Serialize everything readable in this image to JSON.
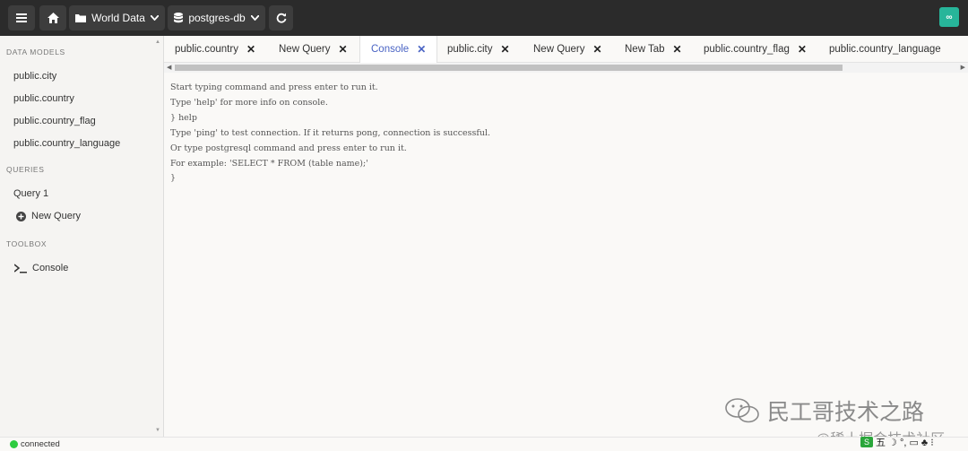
{
  "topbar": {
    "menu_icon": "hamburger-icon",
    "home_icon": "home-icon",
    "database_label": "World Data",
    "connection_label": "postgres-db",
    "refresh_icon": "refresh-icon",
    "app_logo": "app-logo-icon"
  },
  "sidebar": {
    "data_models_title": "DATA MODELS",
    "data_models": [
      {
        "label": "public.city"
      },
      {
        "label": "public.country"
      },
      {
        "label": "public.country_flag"
      },
      {
        "label": "public.country_language"
      }
    ],
    "queries_title": "QUERIES",
    "queries": [
      {
        "label": "Query 1"
      },
      {
        "label": "New Query",
        "icon": "plus-circle-icon"
      }
    ],
    "toolbox_title": "TOOLBOX",
    "toolbox": [
      {
        "label": "Console",
        "icon": "terminal-icon"
      }
    ]
  },
  "tabs": [
    {
      "label": "public.country",
      "active": false
    },
    {
      "label": "New Query",
      "active": false
    },
    {
      "label": "Console",
      "active": true
    },
    {
      "label": "public.city",
      "active": false
    },
    {
      "label": "New Query",
      "active": false
    },
    {
      "label": "New Tab",
      "active": false
    },
    {
      "label": "public.country_flag",
      "active": false
    },
    {
      "label": "public.country_language",
      "active": false
    }
  ],
  "console": {
    "lines": [
      "Start typing command and press enter to run it.",
      "Type 'help' for more info on console.",
      "} help",
      "Type 'ping' to test connection. If it returns pong, connection is successful.",
      "Or type postgresql command and press enter to run it.",
      "For example: 'SELECT * FROM (table name);'",
      "}"
    ]
  },
  "status": {
    "text": "connected",
    "color": "#2ecc40"
  },
  "watermark": {
    "line1": "民工哥技术之路",
    "line2": "@稀土掘金技术社区"
  },
  "colors": {
    "accent": "#4a64c4",
    "topbar": "#2b2b2b",
    "logo": "#27b59a"
  }
}
